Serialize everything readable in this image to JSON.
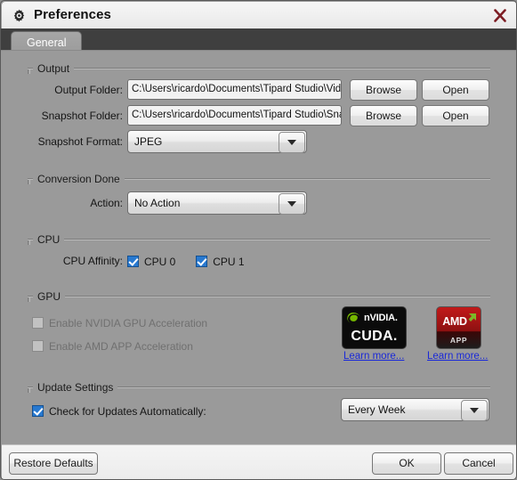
{
  "window": {
    "title": "Preferences",
    "icon": "gear-icon",
    "close_label": "×"
  },
  "tabs": [
    {
      "label": "General",
      "active": true
    }
  ],
  "sections": {
    "output": {
      "legend": "Output",
      "output_folder": {
        "label": "Output Folder:",
        "value": "C:\\Users\\ricardo\\Documents\\Tipard Studio\\Video",
        "browse_label": "Browse",
        "open_label": "Open"
      },
      "snapshot_folder": {
        "label": "Snapshot Folder:",
        "value": "C:\\Users\\ricardo\\Documents\\Tipard Studio\\Snapshot",
        "browse_label": "Browse",
        "open_label": "Open"
      },
      "snapshot_format": {
        "label": "Snapshot Format:",
        "value": "JPEG"
      }
    },
    "conversion_done": {
      "legend": "Conversion Done",
      "action": {
        "label": "Action:",
        "value": "No Action"
      }
    },
    "cpu": {
      "legend": "CPU",
      "affinity_label": "CPU Affinity:",
      "cores": [
        {
          "label": "CPU 0",
          "checked": true
        },
        {
          "label": "CPU 1",
          "checked": true
        }
      ]
    },
    "gpu": {
      "legend": "GPU",
      "nvidia": {
        "label": "Enable NVIDIA GPU Acceleration",
        "checked": false,
        "disabled": true,
        "logo_top": "nVIDIA.",
        "logo_bottom": "CUDA.",
        "learn_more": "Learn more..."
      },
      "amd": {
        "label": "Enable AMD APP Acceleration",
        "checked": false,
        "disabled": true,
        "logo_top": "AMD",
        "logo_bottom": "APP",
        "learn_more": "Learn more..."
      }
    },
    "update_settings": {
      "legend": "Update Settings",
      "auto_check": {
        "label": "Check for Updates Automatically:",
        "checked": true
      },
      "frequency": {
        "value": "Every Week"
      }
    }
  },
  "footer": {
    "restore_defaults": "Restore Defaults",
    "ok": "OK",
    "cancel": "Cancel"
  }
}
